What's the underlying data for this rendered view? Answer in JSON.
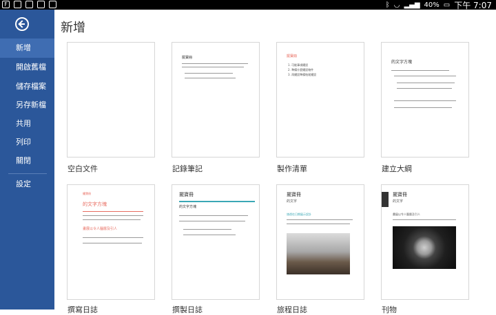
{
  "statusbar": {
    "left_icons": [
      "F",
      "gallery",
      "image",
      "cloud",
      "app"
    ],
    "battery": "40%",
    "time": "下午 7:07"
  },
  "sidebar": {
    "items": [
      {
        "label": "新增",
        "active": true
      },
      {
        "label": "開啟舊檔"
      },
      {
        "label": "儲存檔案"
      },
      {
        "label": "另存新檔"
      },
      {
        "label": "共用"
      },
      {
        "label": "列印"
      },
      {
        "label": "關閉"
      },
      {
        "label": "設定"
      }
    ]
  },
  "page": {
    "title": "新增"
  },
  "templates": [
    {
      "label": "空白文件"
    },
    {
      "label": "記錄筆記",
      "preview": {
        "heading": "擺寶冊"
      }
    },
    {
      "label": "製作清單",
      "preview": {
        "heading": "擺寶冊",
        "items": [
          "1. 可能事項擺設",
          "2. 準備什麼擺設物件",
          "3. 再擺設準備結尾擺設"
        ]
      }
    },
    {
      "label": "建立大綱",
      "preview": {
        "title": "的文字方塊"
      }
    },
    {
      "label": "撰寫日誌",
      "preview": {
        "heading": "擺寶冊",
        "title": "的文字方塊",
        "sub": "畫展以令人腦層及引人"
      }
    },
    {
      "label": "撰製日誌",
      "preview": {
        "heading": "擺寶冊",
        "title": "的文字方塊"
      }
    },
    {
      "label": "旅程日誌",
      "preview": {
        "heading": "擺寶冊",
        "title": "的文字",
        "sub": "旅遊在日期展示設計"
      }
    },
    {
      "label": "刊物",
      "preview": {
        "heading": "擺寶冊",
        "title": "的文字",
        "sub": "畫展以令人腦層及引人"
      }
    }
  ],
  "colors": {
    "sidebar": "#2b579a",
    "sidebar_active": "#3f6db2",
    "accent_red": "#e86b5f",
    "accent_teal": "#3aa7b5"
  }
}
